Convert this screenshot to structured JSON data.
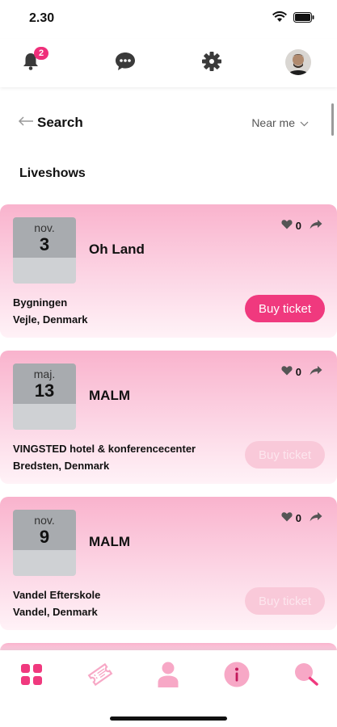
{
  "status": {
    "time": "2.30"
  },
  "top_nav": {
    "notification_count": "2"
  },
  "search": {
    "label": "Search",
    "near_me": "Near me"
  },
  "section": {
    "title": "Liveshows"
  },
  "events": [
    {
      "month": "nov.",
      "day": "3",
      "artist": "Oh Land",
      "likes": "0",
      "venue": "Bygningen",
      "city": "Vejle, Denmark",
      "button": "Buy ticket",
      "button_active": true
    },
    {
      "month": "maj.",
      "day": "13",
      "artist": "MALM",
      "likes": "0",
      "venue": "VINGSTED hotel & konferencecenter",
      "city": "Bredsten, Denmark",
      "button": "Buy ticket",
      "button_active": false
    },
    {
      "month": "nov.",
      "day": "9",
      "artist": "MALM",
      "likes": "0",
      "venue": "Vandel Efterskole",
      "city": "Vandel, Denmark",
      "button": "Buy ticket",
      "button_active": false
    }
  ],
  "colors": {
    "accent": "#f0397e",
    "accent_light": "#f9c9d9",
    "card_top": "#f9b3cd",
    "date_box": "#a8abaf"
  },
  "icons": {
    "notification": "bell-icon",
    "messages": "chat-icon",
    "settings": "gear-icon",
    "profile": "avatar",
    "home": "grid-icon",
    "tickets": "ticket-icon",
    "user": "user-icon",
    "info": "info-icon",
    "search": "search-icon"
  }
}
